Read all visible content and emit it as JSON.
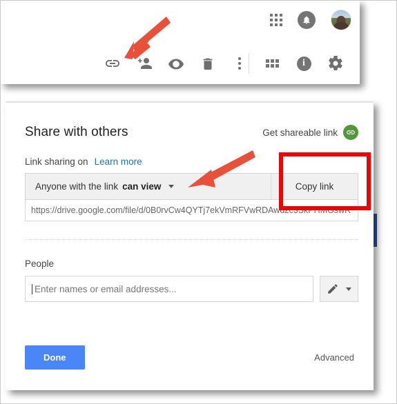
{
  "toolbar": {
    "top_icons": [
      {
        "name": "apps-grid-icon",
        "label": "Google apps"
      },
      {
        "name": "notifications-bell-icon",
        "label": "Notifications"
      },
      {
        "name": "account-avatar",
        "label": "Account"
      }
    ],
    "actions": [
      {
        "name": "get-link-icon",
        "label": "Get shareable link"
      },
      {
        "name": "add-person-icon",
        "label": "Share"
      },
      {
        "name": "preview-eye-icon",
        "label": "Preview"
      },
      {
        "name": "trash-icon",
        "label": "Remove"
      },
      {
        "name": "more-actions-icon",
        "label": "More actions"
      }
    ],
    "right_actions": [
      {
        "name": "grid-view-icon",
        "label": "Switch to grid"
      },
      {
        "name": "info-icon",
        "label": "View details"
      },
      {
        "name": "settings-gear-icon",
        "label": "Settings"
      }
    ],
    "info_glyph": "i"
  },
  "dialog": {
    "title": "Share with others",
    "shareable_link_label": "Get shareable link",
    "shareable_link_icon": "link-icon",
    "link_sharing_status": "Link sharing on",
    "learn_more_label": "Learn more",
    "access_prefix": "Anyone with the link",
    "access_permission": "can view",
    "copy_link_label": "Copy link",
    "share_url": "https://drive.google.com/file/d/0B0rvCw4QYTj7ekVmRFVwRDAwdzc3SkPHMGswR",
    "people_label": "People",
    "people_placeholder": "Enter names or email addresses...",
    "permission_icon": "pencil-icon",
    "done_label": "Done",
    "advanced_label": "Advanced"
  },
  "annotations": {
    "highlight_box": {
      "name": "copy-link-highlight",
      "color": "#f40000"
    },
    "arrow_toolbar": {
      "name": "arrow-to-link-icon",
      "color": "#e8503a"
    },
    "arrow_dropdown": {
      "name": "arrow-to-access-dropdown",
      "color": "#e8503a"
    }
  },
  "colors": {
    "accent_blue": "#4a86f7",
    "link_blue": "#1a73c8",
    "green": "#53973a",
    "annotation_red": "#f40000",
    "arrow_red": "#e8503a"
  }
}
